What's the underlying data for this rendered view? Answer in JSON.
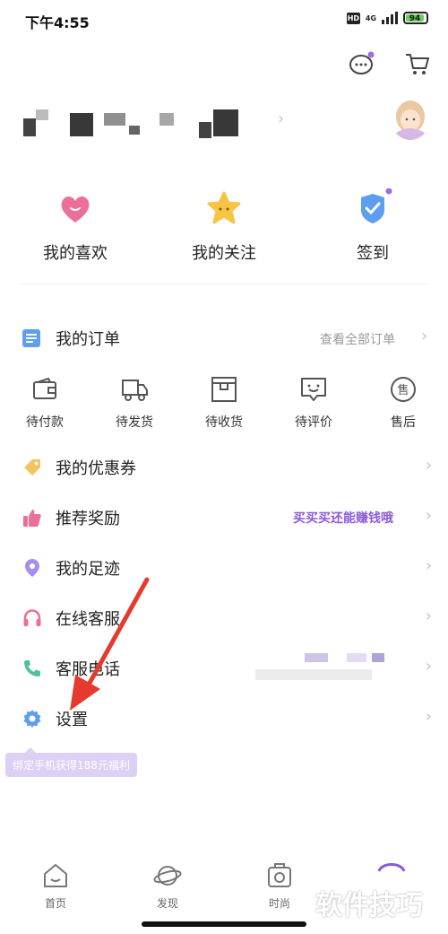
{
  "status_bar": {
    "time": "下午4:55",
    "hd": "HD",
    "network": "4G",
    "battery": "94"
  },
  "header": {
    "icons": [
      "message-icon",
      "cart-icon"
    ]
  },
  "quick_actions": [
    {
      "label": "我的喜欢",
      "icon": "heart-icon"
    },
    {
      "label": "我的关注",
      "icon": "star-icon"
    },
    {
      "label": "签到",
      "icon": "checkin-icon"
    }
  ],
  "orders": {
    "title": "我的订单",
    "view_all": "查看全部订单",
    "items": [
      {
        "label": "待付款",
        "icon": "wallet-icon"
      },
      {
        "label": "待发货",
        "icon": "truck-icon"
      },
      {
        "label": "待收货",
        "icon": "box-icon"
      },
      {
        "label": "待评价",
        "icon": "comment-icon"
      },
      {
        "label": "售后",
        "icon": "after-sale-icon"
      }
    ]
  },
  "menu": {
    "coupons": "我的优惠券",
    "referral": "推荐奖励",
    "referral_promo": "买买买还能赚钱哦",
    "footprint": "我的足迹",
    "service": "在线客服",
    "hotline": "客服电话",
    "settings": "设置"
  },
  "tooltip": "绑定手机获得188元福利",
  "tabbar": [
    "首页",
    "发现",
    "时尚"
  ],
  "watermark": "软件技巧",
  "colors": {
    "accent": "#8c5bd8",
    "promo": "#8c5bd8",
    "red_arrow": "#e63a2e"
  }
}
